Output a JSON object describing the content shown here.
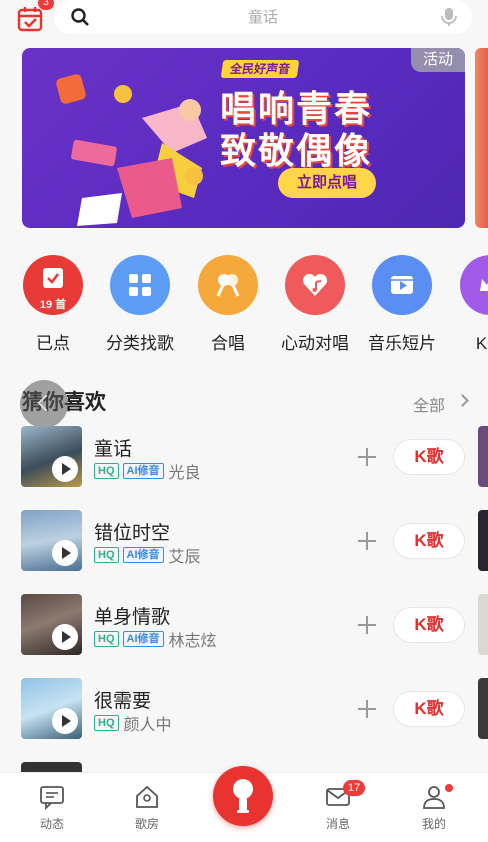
{
  "top_bar": {
    "calendar_badge": "3",
    "search_placeholder": "童话"
  },
  "banner": {
    "tag": "活动",
    "subtitle": "全民好声音",
    "title_line1": "唱响青春",
    "title_line2": "致敬偶像",
    "button": "立即点唱"
  },
  "categories": [
    {
      "label": "已点",
      "badge": "19 首",
      "color": "#e83a36",
      "icon": "checklist-icon"
    },
    {
      "label": "分类找歌",
      "color": "#5c9cf5",
      "icon": "grid-icon"
    },
    {
      "label": "合唱",
      "color": "#f5a93a",
      "icon": "duet-mic-icon"
    },
    {
      "label": "心动对唱",
      "color": "#ef5a5a",
      "icon": "heart-note-icon"
    },
    {
      "label": "音乐短片",
      "color": "#5b8ef2",
      "icon": "film-icon"
    },
    {
      "label": "K歌",
      "color": "#a25be8",
      "icon": "crown-icon"
    }
  ],
  "section": {
    "title": "猜你喜欢",
    "all_label": "全部"
  },
  "songs": [
    {
      "name": "童话",
      "tags": [
        "HQ",
        "AI修音"
      ],
      "artist": "光良",
      "k_label": "K歌"
    },
    {
      "name": "错位时空",
      "tags": [
        "HQ",
        "AI修音"
      ],
      "artist": "艾辰",
      "k_label": "K歌"
    },
    {
      "name": "单身情歌",
      "tags": [
        "HQ",
        "AI修音"
      ],
      "artist": "林志炫",
      "k_label": "K歌"
    },
    {
      "name": "很需要",
      "tags": [
        "HQ"
      ],
      "artist": "颜人中",
      "k_label": "K歌"
    }
  ],
  "bottom_nav": {
    "items": [
      "动态",
      "歌房",
      "消息",
      "我的"
    ],
    "message_badge": "17"
  },
  "colors": {
    "accent": "#e8332f",
    "hq_tag": "#29b38a",
    "ai_tag": "#3d8be0"
  }
}
